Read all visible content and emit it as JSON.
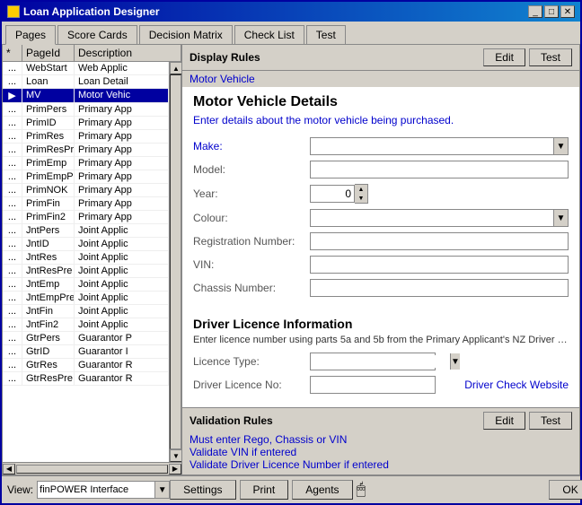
{
  "window": {
    "title": "Loan Application Designer",
    "icon": "loan-icon"
  },
  "tabs": [
    {
      "label": "Pages",
      "active": true
    },
    {
      "label": "Score Cards",
      "active": false
    },
    {
      "label": "Decision Matrix",
      "active": false
    },
    {
      "label": "Check List",
      "active": false
    },
    {
      "label": "Test",
      "active": false
    }
  ],
  "table": {
    "headers": [
      "*",
      "PageId",
      "Description"
    ],
    "rows": [
      {
        "dot": "...",
        "pageId": "WebStart",
        "desc": "Web Applic",
        "active": false
      },
      {
        "dot": "...",
        "pageId": "Loan",
        "desc": "Loan Detail",
        "active": false
      },
      {
        "dot": "▶",
        "pageId": "MV",
        "desc": "Motor Vehic",
        "active": true
      },
      {
        "dot": "...",
        "pageId": "PrimPers",
        "desc": "Primary App",
        "active": false
      },
      {
        "dot": "...",
        "pageId": "PrimID",
        "desc": "Primary App",
        "active": false
      },
      {
        "dot": "...",
        "pageId": "PrimRes",
        "desc": "Primary App",
        "active": false
      },
      {
        "dot": "...",
        "pageId": "PrimResPre",
        "desc": "Primary App",
        "active": false
      },
      {
        "dot": "...",
        "pageId": "PrimEmp",
        "desc": "Primary App",
        "active": false
      },
      {
        "dot": "...",
        "pageId": "PrimEmpPre",
        "desc": "Primary App",
        "active": false
      },
      {
        "dot": "...",
        "pageId": "PrimNOK",
        "desc": "Primary App",
        "active": false
      },
      {
        "dot": "...",
        "pageId": "PrimFin",
        "desc": "Primary App",
        "active": false
      },
      {
        "dot": "...",
        "pageId": "PrimFin2",
        "desc": "Primary App",
        "active": false
      },
      {
        "dot": "...",
        "pageId": "JntPers",
        "desc": "Joint Applic",
        "active": false
      },
      {
        "dot": "...",
        "pageId": "JntID",
        "desc": "Joint Applic",
        "active": false
      },
      {
        "dot": "...",
        "pageId": "JntRes",
        "desc": "Joint Applic",
        "active": false
      },
      {
        "dot": "...",
        "pageId": "JntResPre",
        "desc": "Joint Applic",
        "active": false
      },
      {
        "dot": "...",
        "pageId": "JntEmp",
        "desc": "Joint Applic",
        "active": false
      },
      {
        "dot": "...",
        "pageId": "JntEmpPre",
        "desc": "Joint Applic",
        "active": false
      },
      {
        "dot": "...",
        "pageId": "JntFin",
        "desc": "Joint Applic",
        "active": false
      },
      {
        "dot": "...",
        "pageId": "JntFin2",
        "desc": "Joint Applic",
        "active": false
      },
      {
        "dot": "...",
        "pageId": "GtrPers",
        "desc": "Guarantor P",
        "active": false
      },
      {
        "dot": "...",
        "pageId": "GtrID",
        "desc": "Guarantor I",
        "active": false
      },
      {
        "dot": "...",
        "pageId": "GtrRes",
        "desc": "Guarantor R",
        "active": false
      },
      {
        "dot": "...",
        "pageId": "GtrResPre",
        "desc": "Guarantor R",
        "active": false
      }
    ]
  },
  "display_rules": {
    "label": "Display Rules",
    "breadcrumb": "Motor Vehicle",
    "edit_label": "Edit",
    "test_label": "Test"
  },
  "form": {
    "section_title": "Motor Vehicle Details",
    "section_subtitle": "Enter details about the motor vehicle being purchased.",
    "fields": [
      {
        "label": "Make:",
        "type": "dropdown",
        "value": "",
        "is_blue": true
      },
      {
        "label": "Model:",
        "type": "text",
        "value": ""
      },
      {
        "label": "Year:",
        "type": "spinner",
        "value": "0"
      },
      {
        "label": "Colour:",
        "type": "dropdown",
        "value": ""
      },
      {
        "label": "Registration Number:",
        "type": "text",
        "value": ""
      },
      {
        "label": "VIN:",
        "type": "text",
        "value": ""
      },
      {
        "label": "Chassis Number:",
        "type": "text",
        "value": ""
      }
    ]
  },
  "driver_section": {
    "title": "Driver Licence Information",
    "subtitle": "Enter licence number using parts 5a and 5b from the Primary Applicant's NZ Driver Licenc",
    "fields": [
      {
        "label": "Licence Type:",
        "type": "dropdown",
        "value": ""
      },
      {
        "label": "Driver Licence No:",
        "type": "text_link",
        "value": "",
        "link": "Driver Check Website"
      }
    ]
  },
  "validation": {
    "label": "Validation Rules",
    "edit_label": "Edit",
    "test_label": "Test",
    "rules": [
      "Must enter Rego, Chassis or VIN",
      "Validate VIN if entered",
      "Validate Driver Licence Number if entered"
    ]
  },
  "bottom": {
    "view_label": "View:",
    "view_value": "finPOWER Interface",
    "settings_label": "Settings",
    "print_label": "Print",
    "agents_label": "Agents",
    "ok_label": "OK"
  }
}
